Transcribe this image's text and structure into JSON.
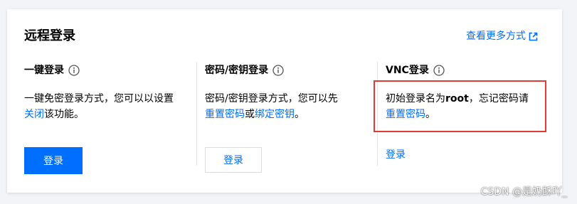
{
  "card": {
    "title": "远程登录",
    "more_link": "查看更多方式"
  },
  "colors": {
    "accent": "#006eff",
    "highlight": "#e53935",
    "divider": "#e5e5e5"
  },
  "icons": {
    "info": "info-circle-icon",
    "external": "external-link-icon"
  },
  "methods": [
    {
      "title": "一键登录",
      "desc_part1": "一键免密登录方式，您可以以设置",
      "link1": "关闭",
      "desc_part2": "该功能。",
      "button": "登录"
    },
    {
      "title": "密码/密钥登录",
      "desc_part1": "密码/密钥登录方式，您可以先",
      "link1": "重置密码",
      "or": "或",
      "link2": "绑定密钥",
      "desc_end": "。",
      "button": "登录"
    },
    {
      "title": "VNC登录",
      "desc_part1": "初始登录名为",
      "username": "root",
      "desc_part2": "，忘记密码请",
      "link1": "重置密码",
      "desc_end": "。",
      "button": "登录"
    }
  ],
  "watermark": "CSDN @是奶酥吖_"
}
